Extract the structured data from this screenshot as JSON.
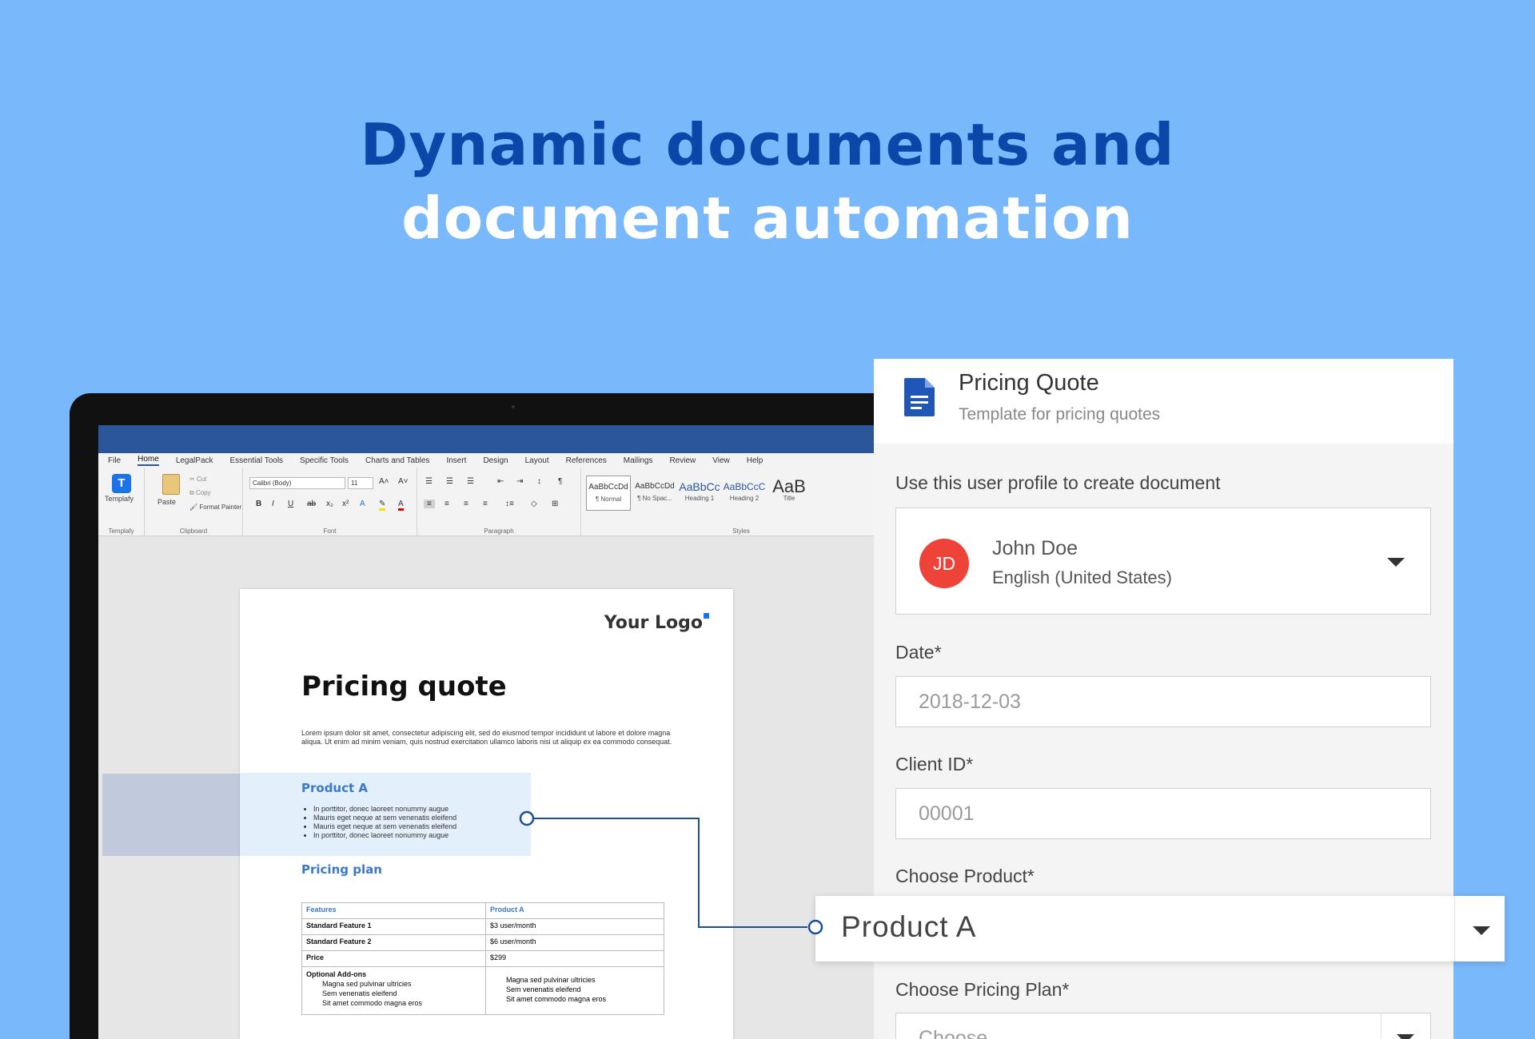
{
  "headline": {
    "line1": "Dynamic documents and",
    "line2": "document automation"
  },
  "word": {
    "tabs": [
      "File",
      "Home",
      "LegalPack",
      "Essential Tools",
      "Specific Tools",
      "Charts and Tables",
      "Insert",
      "Design",
      "Layout",
      "References",
      "Mailings",
      "Review",
      "View",
      "Help"
    ],
    "ribbon": {
      "templafy_label": "Templafy",
      "templafy_group": "Templafy",
      "paste_label": "Paste",
      "cut_label": "Cut",
      "copy_label": "Copy",
      "format_painter_label": "Format Painter",
      "clipboard_group": "Clipboard",
      "font_name": "Calibri (Body)",
      "font_size": "11",
      "font_group": "Font",
      "paragraph_group": "Paragraph",
      "styles_group": "Styles",
      "styles": [
        {
          "sample": "AaBbCcDd",
          "name": "¶ Normal"
        },
        {
          "sample": "AaBbCcDd",
          "name": "¶ No Spac..."
        },
        {
          "sample": "AaBbCc",
          "name": "Heading 1"
        },
        {
          "sample": "AaBbCcC",
          "name": "Heading 2"
        },
        {
          "sample": "AaB",
          "name": "Title"
        }
      ]
    },
    "document": {
      "logo": "Your Logo",
      "title": "Pricing quote",
      "lorem": "Lorem ipsum dolor sit amet, consectetur adipiscing elit, sed do eiusmod tempor incididunt ut labore et dolore magna aliqua. Ut enim ad minim veniam, quis nostrud exercitation ullamco laboris nisi ut aliquip ex ea commodo consequat.",
      "product_heading": "Product A",
      "bullets": [
        "In porttitor, donec laoreet nonummy augue",
        "Mauris eget neque at sem venenatis eleifend",
        "Mauris eget neque at sem venenatis eleifend",
        "In porttitor, donec laoreet nonummy augue"
      ],
      "plan_heading": "Pricing plan",
      "table": {
        "headers": [
          "Features",
          "Product A"
        ],
        "rows": [
          [
            "Standard Feature 1",
            "$3 user/month"
          ],
          [
            "Standard Feature 2",
            "$6 user/month"
          ],
          [
            "Price",
            "$299"
          ]
        ],
        "addons_label": "Optional Add-ons",
        "addons_left": [
          "Magna sed pulvinar ultricies",
          "Sem venenatis eleifend",
          "Sit amet commodo magna eros"
        ],
        "addons_right": [
          "Magna sed pulvinar ultricies",
          "Sem venenatis eleifend",
          "Sit amet commodo magna eros"
        ]
      }
    }
  },
  "panel": {
    "title": "Pricing Quote",
    "subtitle": "Template for pricing quotes",
    "profile_label": "Use this user profile to create document",
    "profile": {
      "initials": "JD",
      "name": "John Doe",
      "language": "English (United States)",
      "avatar_color": "#ee4338"
    },
    "date_label": "Date*",
    "date_value": "2018-12-03",
    "client_label": "Client ID*",
    "client_value": "00001",
    "product_label": "Choose Product*",
    "product_value": "Product A",
    "plan_label": "Choose Pricing Plan*",
    "plan_placeholder": "Choose"
  },
  "colors": {
    "background": "#79b8fb",
    "headline_dark": "#0a47a9",
    "word_blue": "#2b579a",
    "accent_blue": "#3a78c9"
  }
}
